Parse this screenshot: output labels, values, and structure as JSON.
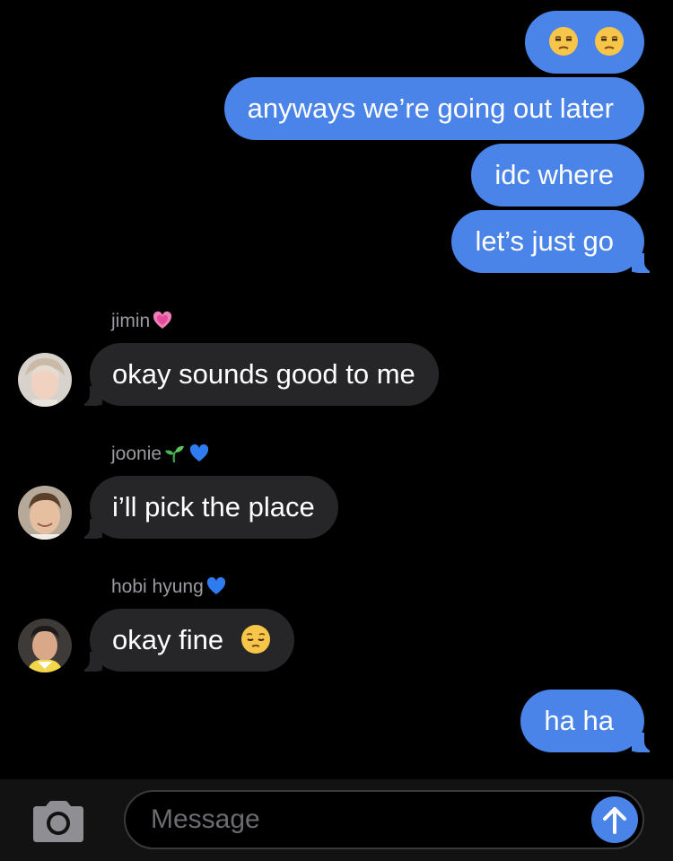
{
  "colors": {
    "background": "#000000",
    "sent_bubble": "#4b84e8",
    "received_bubble": "#262628",
    "sender_label": "#9a9a9f",
    "input_bar": "#121212"
  },
  "messages": {
    "sent": [
      {
        "text": "",
        "emoji": [
          "unamused-face",
          "unamused-face"
        ]
      },
      {
        "text": "anyways we’re going out later"
      },
      {
        "text": "idc where"
      },
      {
        "text": "let’s just go"
      }
    ],
    "received": [
      {
        "sender": "jimin",
        "sender_emoji": [
          "growing-heart"
        ],
        "text": "okay sounds good to me"
      },
      {
        "sender": "joonie",
        "sender_emoji": [
          "seedling",
          "blue-heart"
        ],
        "text": "i’ll pick the place"
      },
      {
        "sender": "hobi hyung",
        "sender_emoji": [
          "blue-heart"
        ],
        "text": "okay fine",
        "text_emoji": "pensive-face"
      }
    ],
    "last_sent": {
      "text": "ha ha"
    }
  },
  "input": {
    "placeholder": "Message"
  },
  "icons": {
    "camera": "camera-icon",
    "send": "send-arrow-up-icon"
  }
}
